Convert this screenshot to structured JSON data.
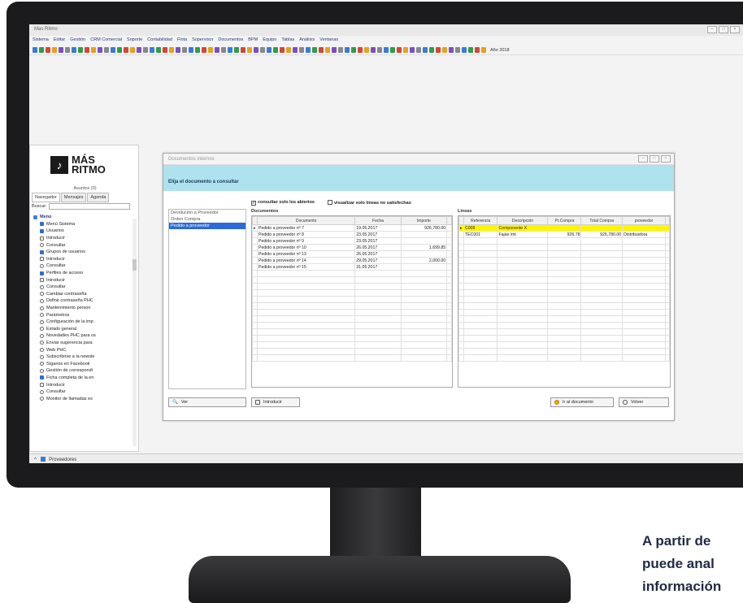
{
  "app": {
    "title": "Mas Ritmo",
    "menu": [
      "Sistema",
      "Editar",
      "Gestión",
      "CRM Comercial",
      "Soporte",
      "Contabilidad",
      "Flota",
      "Supervisor",
      "Documentos",
      "BPM",
      "Equipo",
      "Tablas",
      "Análisis",
      "Ventanas"
    ],
    "toolbar_year": "Año 2018",
    "status_text": "Proveedores"
  },
  "sidebar": {
    "logo_top": "MÁS",
    "logo_bottom": "RITMO",
    "assets_label": "Asuntos (0)",
    "tabs": [
      "Navegador",
      "Mensajes",
      "Agenda"
    ],
    "search_label": "Buscar:",
    "tree_root": "Menú",
    "tree": [
      {
        "label": "Menú Sistema",
        "kind": "folder"
      },
      {
        "label": "Usuarios",
        "kind": "folder"
      },
      {
        "label": "Introducir",
        "kind": "doc"
      },
      {
        "label": "Consultar",
        "kind": "gear"
      },
      {
        "label": "Grupos de usuarios",
        "kind": "folder"
      },
      {
        "label": "Introducir",
        "kind": "doc"
      },
      {
        "label": "Consultar",
        "kind": "gear"
      },
      {
        "label": "Perfiles de acceso",
        "kind": "folder"
      },
      {
        "label": "Introducir",
        "kind": "doc"
      },
      {
        "label": "Consultar",
        "kind": "gear"
      },
      {
        "label": "Cambiar contraseña",
        "kind": "gear"
      },
      {
        "label": "Definir contraseña PHC",
        "kind": "gear"
      },
      {
        "label": "Mantenimiento person",
        "kind": "gear"
      },
      {
        "label": "Parámetros",
        "kind": "gear"
      },
      {
        "label": "Configuración de la imp",
        "kind": "gear"
      },
      {
        "label": "Estado general",
        "kind": "gear"
      },
      {
        "label": "Novedades PHC para us",
        "kind": "gear"
      },
      {
        "label": "Enviar sugerencia para",
        "kind": "gear"
      },
      {
        "label": "Web PHC",
        "kind": "gear"
      },
      {
        "label": "Subscribirse a la newsle",
        "kind": "gear"
      },
      {
        "label": "Síganos en Facebook",
        "kind": "gear"
      },
      {
        "label": "Gestión de correspondi",
        "kind": "gear"
      },
      {
        "label": "Ficha completa de la en",
        "kind": "folder"
      },
      {
        "label": "Introducir",
        "kind": "doc"
      },
      {
        "label": "Consultar",
        "kind": "gear"
      },
      {
        "label": "Monitor de llamadas es",
        "kind": "gear"
      }
    ]
  },
  "dialog": {
    "title": "Documentos internos",
    "prompt": "Elija el documento a consultar",
    "check_open": "consultar solo los abiertos",
    "check_unsatisfied": "visualizar solo líneas no satisfechas",
    "doc_types": [
      "Devolución a Proveedor",
      "Orden Compra",
      "Pedido a proveedor"
    ],
    "docs_label": "Documentos",
    "lines_label": "Líneas",
    "docs_columns": [
      "Documento",
      "Fecha",
      "Importe"
    ],
    "docs_rows": [
      [
        "Pedido a proveedor nº 7",
        "19.05.2017",
        "926,780.00"
      ],
      [
        "Pedido a proveedor nº 8",
        "23.05.2017",
        ""
      ],
      [
        "Pedido a proveedor nº 9",
        "23.05.2017",
        ""
      ],
      [
        "Pedido a proveedor nº 10",
        "26.05.2017",
        "1,699.85"
      ],
      [
        "Pedido a proveedor nº 13",
        "26.05.2017",
        ""
      ],
      [
        "Pedido a proveedor nº 14",
        "29.05.2017",
        "2,000.00"
      ],
      [
        "Pedido a proveedor nº 15",
        "31.05.2017",
        ""
      ]
    ],
    "lines_columns": [
      "Referencia",
      "Descripción",
      "Pr.Compra",
      "Total Compra",
      "proveedor"
    ],
    "lines_rows": [
      [
        "C009",
        "Componente X",
        "",
        "",
        ""
      ],
      [
        "TEC001",
        "Fajas /mt",
        "926.78",
        "926,780.00",
        "Distribuidora"
      ]
    ],
    "btn_view": "Ver",
    "btn_insert": "Introducir",
    "btn_goto": "Ir al documento",
    "btn_back": "Volver"
  },
  "tagline": [
    "A partir de",
    "puede anal",
    "información"
  ]
}
